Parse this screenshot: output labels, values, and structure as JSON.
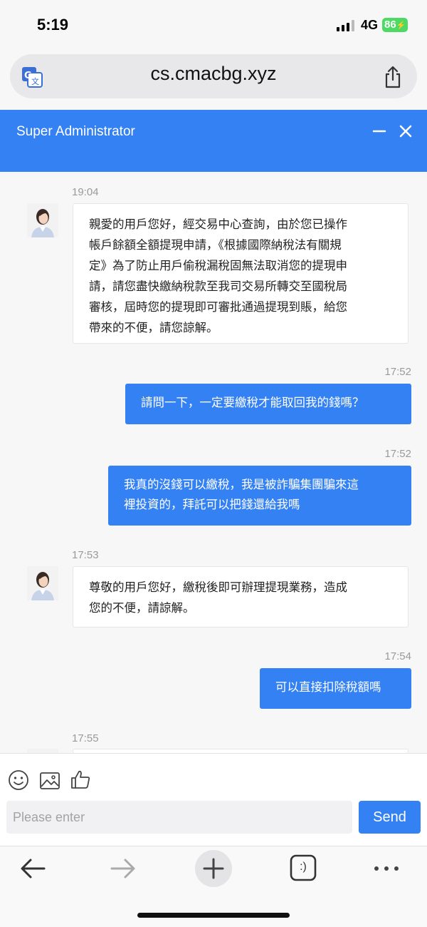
{
  "status_bar": {
    "time": "5:19",
    "network": "4G",
    "battery": "86",
    "battery_color": "#4cd964"
  },
  "browser": {
    "url": "cs.cmacbg.xyz",
    "input_placeholder": "Please enter",
    "input_value": ""
  },
  "chat": {
    "title": "Super Administrator",
    "accent_color": "#3481f4",
    "messages": [
      {
        "side": "incoming",
        "time": "19:04",
        "lines": [
          "親愛的用戶您好，經交易中心查詢，由於您已操作",
          "帳戶餘額全額提現申請，《根據國際納稅法有關規",
          "定》為了防止用戶偷稅漏稅固無法取消您的提現申",
          "請，請您盡快繳納稅款至我司交易所轉交至國稅局",
          "審核，屆時您的提現即可審批通過提現到賬，給您",
          "帶來的不便，請您諒解。"
        ]
      },
      {
        "side": "outgoing",
        "time": "17:52",
        "lines": [
          "請問一下，一定要繳稅才能取回我的錢嗎？"
        ]
      },
      {
        "side": "outgoing",
        "time": "17:52",
        "lines": [
          "我真的沒錢可以繳稅，我是被詐騙集團騙來這",
          "裡投資的，拜託可以把錢還給我嗎"
        ]
      },
      {
        "side": "incoming",
        "time": "17:53",
        "lines": [
          "尊敬的用戶您好，繳稅後即可辦理提現業務，造成",
          "您的不便，請諒解。"
        ]
      },
      {
        "side": "outgoing",
        "time": "17:54",
        "lines": [
          "可以直接扣除稅額嗎"
        ]
      },
      {
        "side": "incoming",
        "time": "17:55",
        "lines": []
      }
    ],
    "send_label": "Send",
    "tools": [
      "smiley-icon",
      "image-icon",
      "thumbs-up-icon"
    ]
  },
  "toolbar": {
    "tabs_label": ":)",
    "icons": [
      "back-arrow-icon",
      "forward-arrow-icon",
      "new-tab-icon",
      "tabs-icon",
      "more-icon"
    ]
  }
}
